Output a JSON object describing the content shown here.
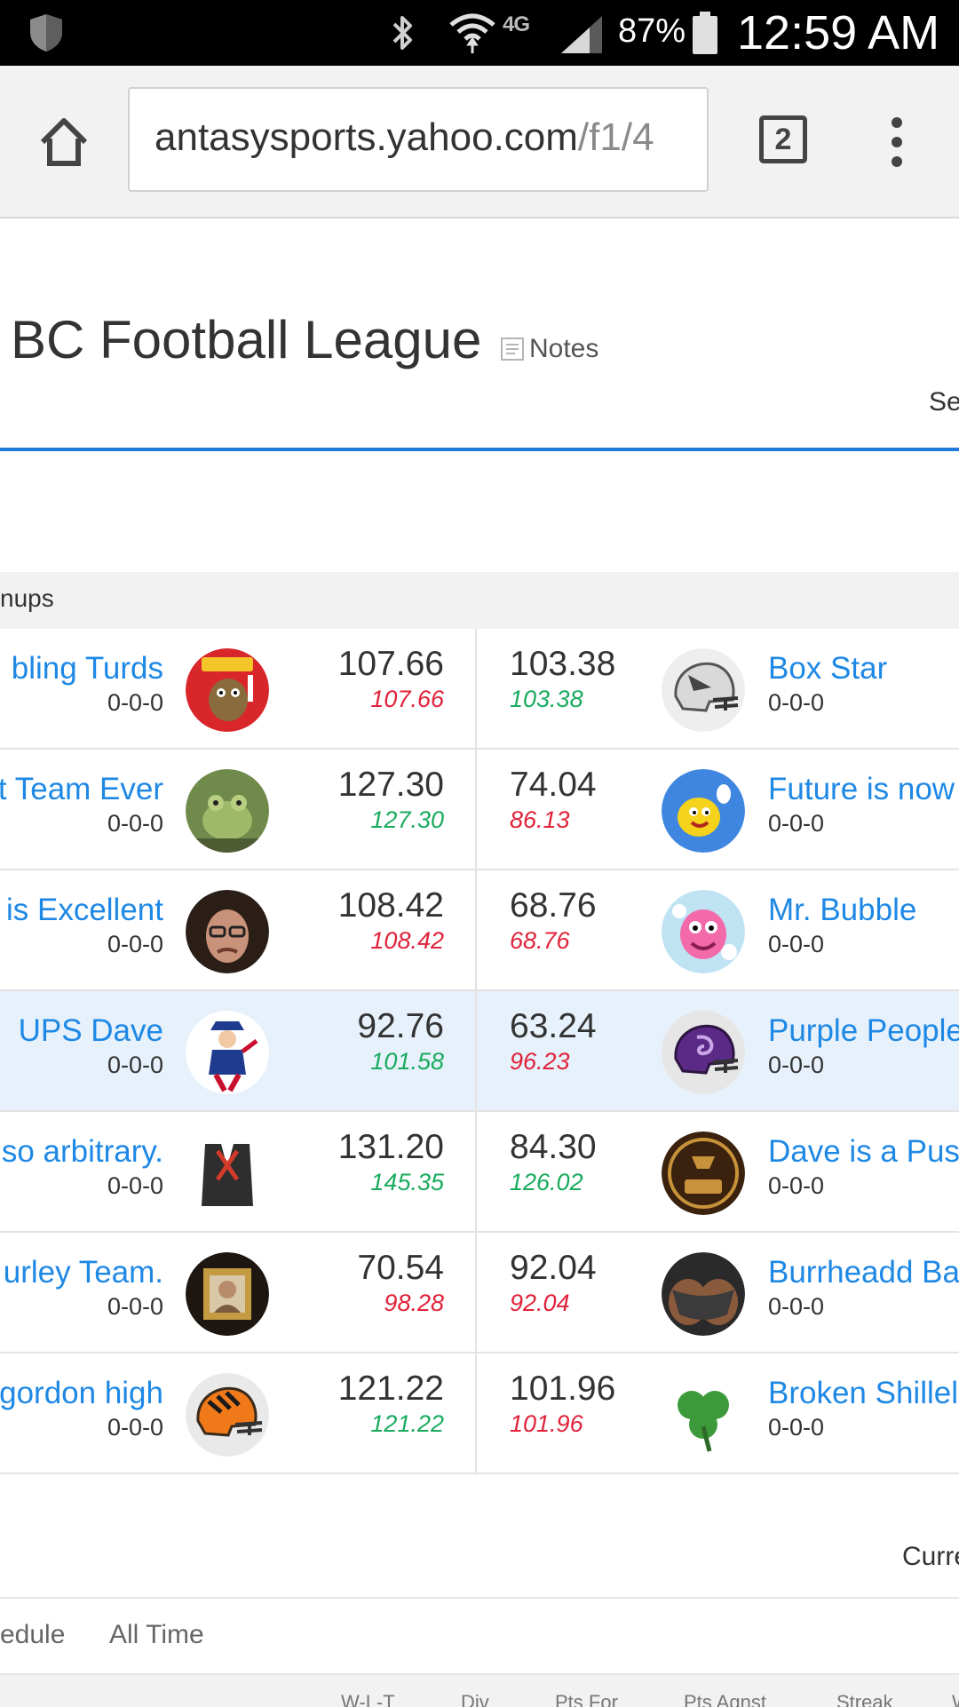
{
  "status_bar": {
    "network": "4G",
    "battery": "87%",
    "time": "12:59 AM",
    "icons": [
      "shield-icon",
      "bluetooth-icon",
      "wifi-icon",
      "signal-icon",
      "battery-icon"
    ]
  },
  "browser": {
    "url_host": "antasysports.yahoo.com",
    "url_path": "/f1/4",
    "tab_count": "2",
    "icons": [
      "home-icon",
      "tabs-icon",
      "overflow-menu-icon"
    ]
  },
  "league": {
    "title": "BC Football League",
    "notes_label": "Notes",
    "right_link": "Se"
  },
  "matchups": {
    "heading": "nups",
    "rows": [
      {
        "left": {
          "name": "bling Turds",
          "record": "0-0-0",
          "score": "107.66",
          "proj": "107.66",
          "proj_color": "red",
          "avatar": "turds"
        },
        "right": {
          "name": "Box Star",
          "record": "0-0-0",
          "score": "103.38",
          "proj": "103.38",
          "proj_color": "green",
          "avatar": "helmet-gray"
        }
      },
      {
        "left": {
          "name": "t Team Ever",
          "record": "0-0-0",
          "score": "127.30",
          "proj": "127.30",
          "proj_color": "green",
          "avatar": "frog"
        },
        "right": {
          "name": "Future is now",
          "record": "0-0-0",
          "score": "74.04",
          "proj": "86.13",
          "proj_color": "red",
          "avatar": "lemon"
        }
      },
      {
        "left": {
          "name": " is Excellent",
          "record": "0-0-0",
          "score": "108.42",
          "proj": "108.42",
          "proj_color": "red",
          "avatar": "man"
        },
        "right": {
          "name": "Mr. Bubble",
          "record": "0-0-0",
          "score": "68.76",
          "proj": "68.76",
          "proj_color": "red",
          "avatar": "bubble"
        }
      },
      {
        "left": {
          "name": "UPS Dave",
          "record": "0-0-0",
          "score": "92.76",
          "proj": "101.58",
          "proj_color": "green",
          "avatar": "patriot"
        },
        "right": {
          "name": "Purple People",
          "record": "0-0-0",
          "score": "63.24",
          "proj": "96.23",
          "proj_color": "red",
          "avatar": "helmet-purple"
        }
      },
      {
        "left": {
          "name": "so arbitrary.",
          "record": "0-0-0",
          "score": "131.20",
          "proj": "145.35",
          "proj_color": "green",
          "avatar": "vest"
        },
        "right": {
          "name": "Dave is a Pus",
          "record": "0-0-0",
          "score": "84.30",
          "proj": "126.02",
          "proj_color": "green",
          "avatar": "fluff"
        }
      },
      {
        "left": {
          "name": "urley Team.",
          "record": "0-0-0",
          "score": "70.54",
          "proj": "98.28",
          "proj_color": "red",
          "avatar": "frame"
        },
        "right": {
          "name": "Burrheadd Ba",
          "record": "0-0-0",
          "score": "92.04",
          "proj": "92.04",
          "proj_color": "red",
          "avatar": "butt"
        }
      },
      {
        "left": {
          "name": "gordon high",
          "record": "0-0-0",
          "score": "121.22",
          "proj": "121.22",
          "proj_color": "green",
          "avatar": "helmet-orange"
        },
        "right": {
          "name": "Broken Shillel",
          "record": "0-0-0",
          "score": "101.96",
          "proj": "101.96",
          "proj_color": "red",
          "avatar": "shamrock"
        }
      }
    ]
  },
  "standings": {
    "current_label": "Curre",
    "tabs": [
      "edule",
      "All Time"
    ],
    "columns": [
      "W-L-T",
      "Div",
      "Pts For",
      "Pts Agnst",
      "Streak",
      "W"
    ]
  },
  "colors": {
    "link_blue": "#1e88e5",
    "proj_red": "#e0223a",
    "proj_green": "#1aab5e",
    "accent_rule": "#1f7ad9",
    "highlight_row": "#e6f1fb"
  }
}
